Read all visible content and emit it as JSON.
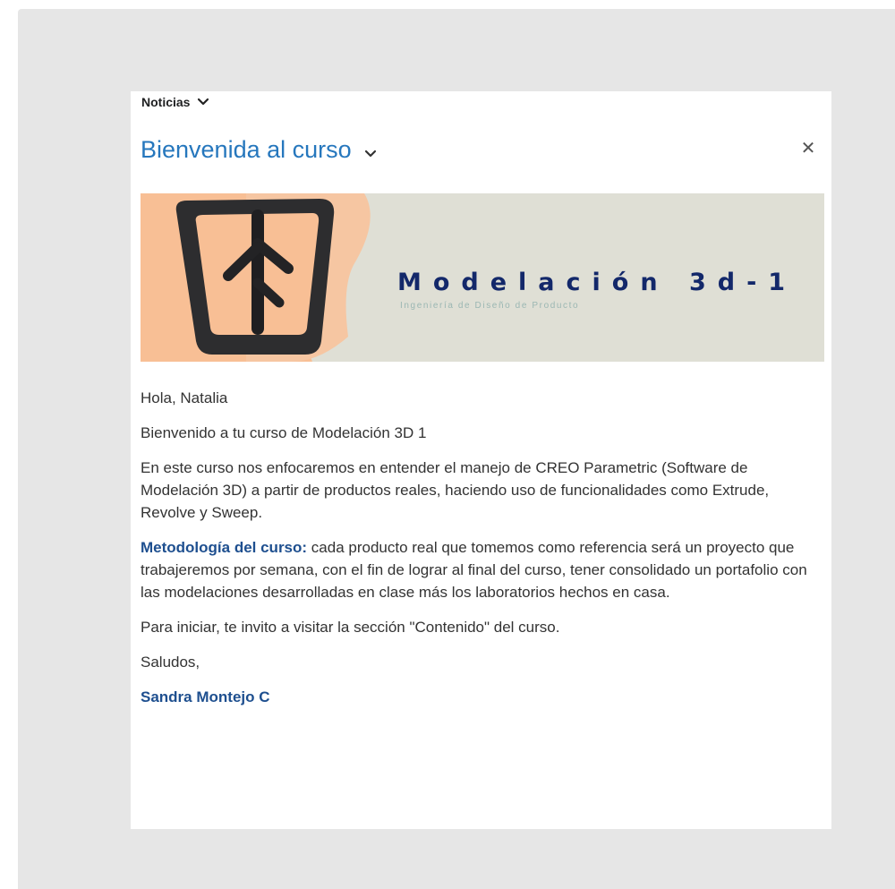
{
  "widget": {
    "label": "Noticias"
  },
  "announcement": {
    "title": "Bienvenida al curso"
  },
  "banner": {
    "title": "Modelación 3d-1",
    "subtitle": "Ingeniería de Diseño de Producto"
  },
  "message": {
    "greeting": "Hola, Natalia",
    "welcome": "Bienvenido a tu curso de Modelación 3D 1",
    "intro": "En este curso nos enfocaremos en entender el manejo de CREO Parametric (Software de Modelación 3D) a partir de productos reales, haciendo uso de funcionalidades como Extrude, Revolve y Sweep.",
    "methodology_label": "Metodología del curso:",
    "methodology_text": " cada producto real que tomemos como referencia será un proyecto que trabajeremos por semana, con el fin de lograr al final del curso, tener consolidado un portafolio con las modelaciones desarrolladas en clase más los laboratorios hechos en casa.",
    "start": "Para iniciar, te invito a visitar la sección \"Contenido\" del curso.",
    "closing": "Saludos,",
    "signature": "Sandra Montejo C"
  },
  "colors": {
    "title": "#2677bd",
    "link": "#1e4f8f",
    "banner_title": "#13286a",
    "banner_bg": "#dfdfd5",
    "banner_accent": "#f8bf95"
  },
  "icons": {
    "widget_menu": "chevron-down-icon",
    "title_menu": "chevron-down-icon",
    "dismiss": "close-icon"
  }
}
